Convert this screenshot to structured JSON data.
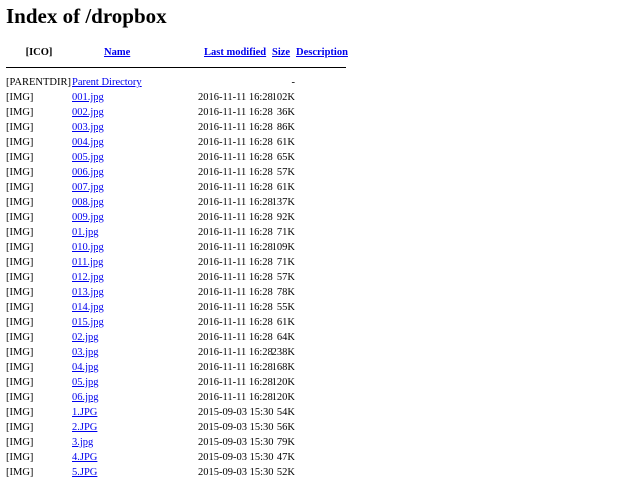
{
  "page": {
    "title": "Index of /dropbox"
  },
  "table": {
    "headers": {
      "icon": "[ICO]",
      "name": "Name",
      "last_modified": "Last modified",
      "size": "Size",
      "description": "Description"
    },
    "parent": {
      "icon": "[PARENTDIR]",
      "name": "Parent Directory",
      "size": "-"
    },
    "rows": [
      {
        "icon": "[IMG]",
        "name": "001.jpg",
        "modified": "2016-11-11 16:28",
        "size": "102K"
      },
      {
        "icon": "[IMG]",
        "name": "002.jpg",
        "modified": "2016-11-11 16:28",
        "size": "36K"
      },
      {
        "icon": "[IMG]",
        "name": "003.jpg",
        "modified": "2016-11-11 16:28",
        "size": "86K"
      },
      {
        "icon": "[IMG]",
        "name": "004.jpg",
        "modified": "2016-11-11 16:28",
        "size": "61K"
      },
      {
        "icon": "[IMG]",
        "name": "005.jpg",
        "modified": "2016-11-11 16:28",
        "size": "65K"
      },
      {
        "icon": "[IMG]",
        "name": "006.jpg",
        "modified": "2016-11-11 16:28",
        "size": "57K"
      },
      {
        "icon": "[IMG]",
        "name": "007.jpg",
        "modified": "2016-11-11 16:28",
        "size": "61K"
      },
      {
        "icon": "[IMG]",
        "name": "008.jpg",
        "modified": "2016-11-11 16:28",
        "size": "137K"
      },
      {
        "icon": "[IMG]",
        "name": "009.jpg",
        "modified": "2016-11-11 16:28",
        "size": "92K"
      },
      {
        "icon": "[IMG]",
        "name": "01.jpg",
        "modified": "2016-11-11 16:28",
        "size": "71K"
      },
      {
        "icon": "[IMG]",
        "name": "010.jpg",
        "modified": "2016-11-11 16:28",
        "size": "109K"
      },
      {
        "icon": "[IMG]",
        "name": "011.jpg",
        "modified": "2016-11-11 16:28",
        "size": "71K"
      },
      {
        "icon": "[IMG]",
        "name": "012.jpg",
        "modified": "2016-11-11 16:28",
        "size": "57K"
      },
      {
        "icon": "[IMG]",
        "name": "013.jpg",
        "modified": "2016-11-11 16:28",
        "size": "78K"
      },
      {
        "icon": "[IMG]",
        "name": "014.jpg",
        "modified": "2016-11-11 16:28",
        "size": "55K"
      },
      {
        "icon": "[IMG]",
        "name": "015.jpg",
        "modified": "2016-11-11 16:28",
        "size": "61K"
      },
      {
        "icon": "[IMG]",
        "name": "02.jpg",
        "modified": "2016-11-11 16:28",
        "size": "64K"
      },
      {
        "icon": "[IMG]",
        "name": "03.jpg",
        "modified": "2016-11-11 16:28",
        "size": "238K"
      },
      {
        "icon": "[IMG]",
        "name": "04.jpg",
        "modified": "2016-11-11 16:28",
        "size": "168K"
      },
      {
        "icon": "[IMG]",
        "name": "05.jpg",
        "modified": "2016-11-11 16:28",
        "size": "120K"
      },
      {
        "icon": "[IMG]",
        "name": "06.jpg",
        "modified": "2016-11-11 16:28",
        "size": "120K"
      },
      {
        "icon": "[IMG]",
        "name": "1.JPG",
        "modified": "2015-09-03 15:30",
        "size": "54K"
      },
      {
        "icon": "[IMG]",
        "name": "2.JPG",
        "modified": "2015-09-03 15:30",
        "size": "56K"
      },
      {
        "icon": "[IMG]",
        "name": "3.jpg",
        "modified": "2015-09-03 15:30",
        "size": "79K"
      },
      {
        "icon": "[IMG]",
        "name": "4.JPG",
        "modified": "2015-09-03 15:30",
        "size": "47K"
      },
      {
        "icon": "[IMG]",
        "name": "5.JPG",
        "modified": "2015-09-03 15:30",
        "size": "52K"
      }
    ]
  },
  "colors": {
    "link": "#0000ee",
    "text": "#000000",
    "background": "#ffffff"
  }
}
